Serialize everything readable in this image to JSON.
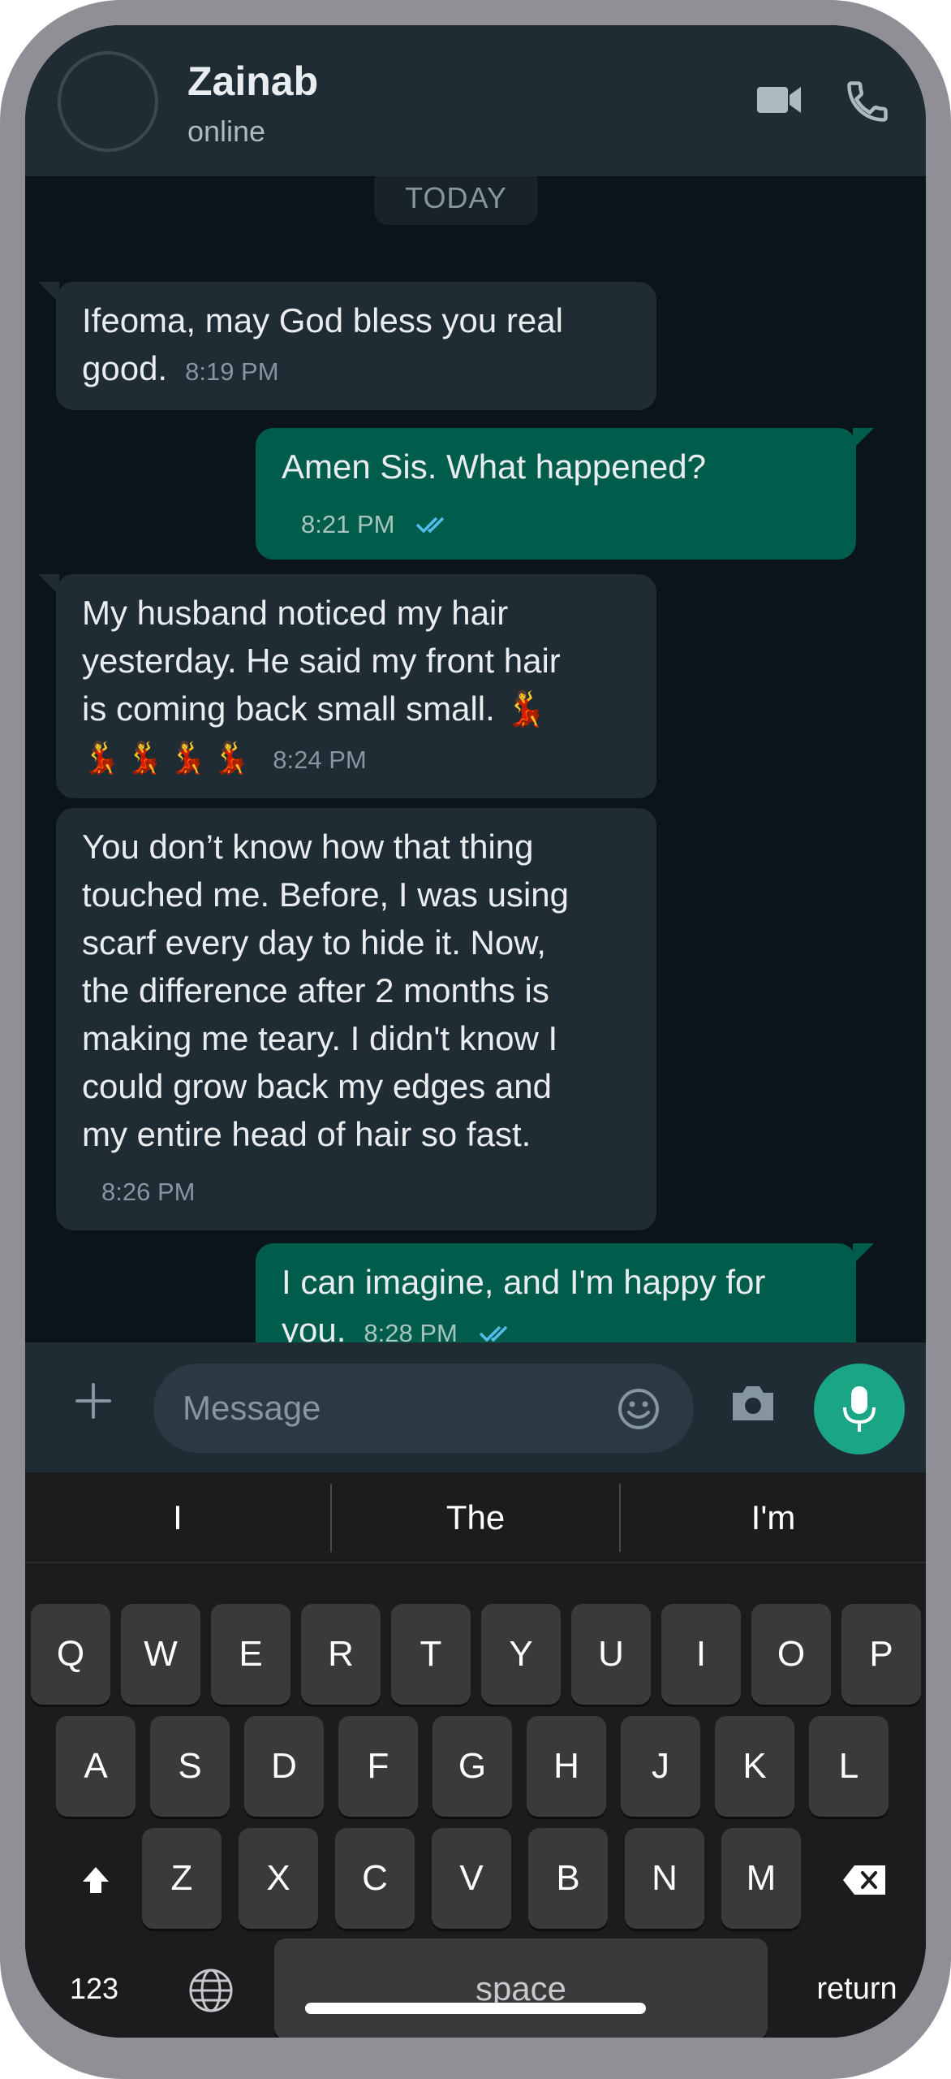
{
  "header": {
    "contact_name": "Zainab",
    "status": "online"
  },
  "chat": {
    "date_label": "TODAY",
    "messages": [
      {
        "direction": "in",
        "text": "Ifeoma, may God bless you real\ngood.",
        "time": "8:19 PM"
      },
      {
        "direction": "out",
        "text": "Amen Sis. What happened?",
        "time": "8:21 PM",
        "status": "read"
      },
      {
        "direction": "in",
        "text": "My husband noticed my hair\nyesterday. He said my front hair\nis coming back small small. 💃",
        "emoji_row": "💃💃💃💃",
        "time": "8:24 PM"
      },
      {
        "direction": "in",
        "text": "You don’t know how that thing\ntouched me. Before, I was using\nscarf every day to hide it. Now,\nthe difference after 2 months is\nmaking me teary. I didn't know I\ncould grow back my edges and\nmy entire head of hair so fast.",
        "time": "8:26 PM"
      },
      {
        "direction": "out",
        "text": "I can imagine, and I'm happy for\nyou.",
        "time": "8:28 PM",
        "status": "read"
      }
    ]
  },
  "input": {
    "placeholder": "Message"
  },
  "keyboard": {
    "suggestions": [
      "I",
      "The",
      "I'm"
    ],
    "row1": [
      "Q",
      "W",
      "E",
      "R",
      "T",
      "Y",
      "U",
      "I",
      "O",
      "P"
    ],
    "row2": [
      "A",
      "S",
      "D",
      "F",
      "G",
      "H",
      "J",
      "K",
      "L"
    ],
    "row3": [
      "Z",
      "X",
      "C",
      "V",
      "B",
      "N",
      "M"
    ],
    "numbers_label": "123",
    "space_label": "space",
    "return_label": "return"
  },
  "colors": {
    "incoming_bubble": "#202c33",
    "outgoing_bubble": "#005c4b",
    "accent": "#1aa585",
    "read_tick": "#53bdeb"
  },
  "icons": {
    "video": "video-camera-icon",
    "phone": "phone-icon",
    "plus": "plus-icon",
    "emoji": "emoji-icon",
    "camera": "camera-icon",
    "mic": "microphone-icon",
    "shift": "shift-icon",
    "backspace": "backspace-icon",
    "globe": "globe-icon"
  }
}
